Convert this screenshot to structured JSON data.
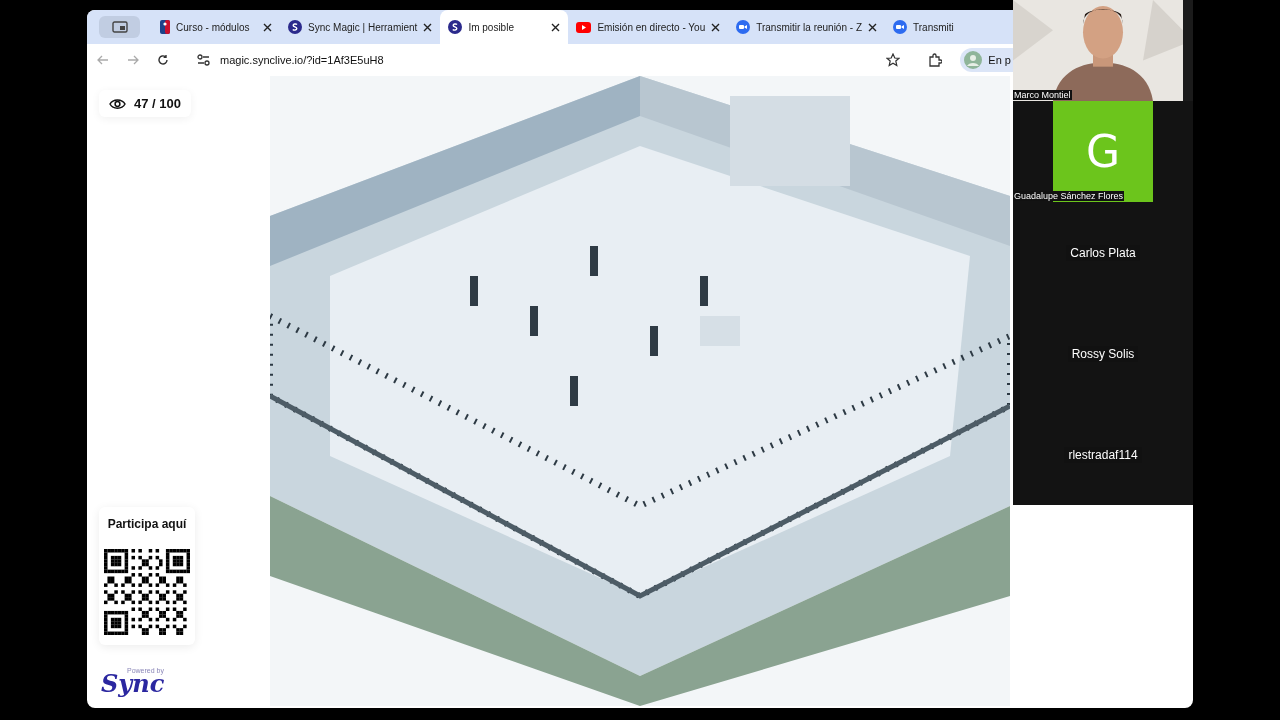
{
  "browser": {
    "tabs": [
      {
        "kind": "group",
        "selected": false
      },
      {
        "kind": "badge",
        "title": "Curso - módulos",
        "selected": false,
        "closable": true
      },
      {
        "kind": "sync",
        "title": "Sync Magic | Herramient",
        "selected": false,
        "closable": true
      },
      {
        "kind": "sync",
        "title": "Im posible",
        "selected": true,
        "closable": true
      },
      {
        "kind": "play",
        "title": "Emisión en directo - You",
        "selected": false,
        "closable": true
      },
      {
        "kind": "meeting",
        "title": "Transmitir la reunión - Z",
        "selected": false,
        "closable": true
      },
      {
        "kind": "meeting",
        "title": "Transmiti",
        "selected": false,
        "closable": false
      }
    ],
    "url": "magic.synclive.io/?id=1Af3E5uH8",
    "profile_label": "En p"
  },
  "page": {
    "viewers": "47 / 100",
    "join_label": "Participa aquí",
    "powered_by": "Powered by",
    "brand": "Sync"
  },
  "meeting": {
    "participants": [
      {
        "kind": "video",
        "name": "Marco Montiel"
      },
      {
        "kind": "avatar",
        "initial": "G",
        "name": "Guadalupe Sánchez Flores",
        "color": "#6cc51c"
      },
      {
        "kind": "name",
        "name": "Carlos Plata"
      },
      {
        "kind": "name",
        "name": "Rossy Solis"
      },
      {
        "kind": "name",
        "name": "rlestradaf114"
      }
    ]
  }
}
